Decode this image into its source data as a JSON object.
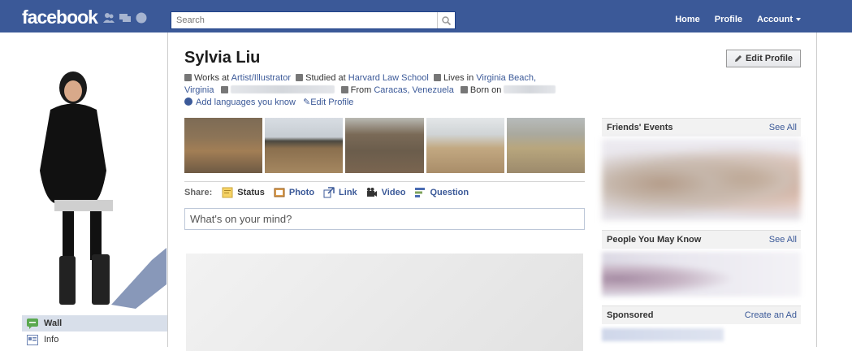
{
  "topbar": {
    "logo": "facebook",
    "search_placeholder": "Search",
    "nav": {
      "home": "Home",
      "profile": "Profile",
      "account": "Account"
    }
  },
  "profile": {
    "name": "Sylvia Liu",
    "edit_button": "Edit Profile",
    "info": {
      "works_prefix": "Works at",
      "works_at": "Artist/Illustrator",
      "studied_prefix": "Studied at",
      "studied_at": "Harvard Law School",
      "lives_prefix": "Lives in",
      "lives_in_a": "Virginia Beach,",
      "lives_in_b": "Virginia",
      "from_prefix": "From",
      "from": "Caracas, Venezuela",
      "born_prefix": "Born on",
      "add_languages": "Add languages you know",
      "edit_profile_link": "Edit Profile"
    }
  },
  "left_nav": [
    {
      "label": "Wall",
      "active": true
    },
    {
      "label": "Info",
      "active": false
    }
  ],
  "share": {
    "label": "Share:",
    "items": [
      "Status",
      "Photo",
      "Link",
      "Video",
      "Question"
    ],
    "placeholder": "What's on your mind?"
  },
  "sidebar": {
    "friends_events": {
      "title": "Friends' Events",
      "link": "See All"
    },
    "people_you_may_know": {
      "title": "People You May Know",
      "link": "See All"
    },
    "sponsored": {
      "title": "Sponsored",
      "link": "Create an Ad"
    }
  },
  "colors": {
    "brand": "#3b5998",
    "nav_active_bg": "#d8dfea",
    "link": "#3b5998"
  }
}
